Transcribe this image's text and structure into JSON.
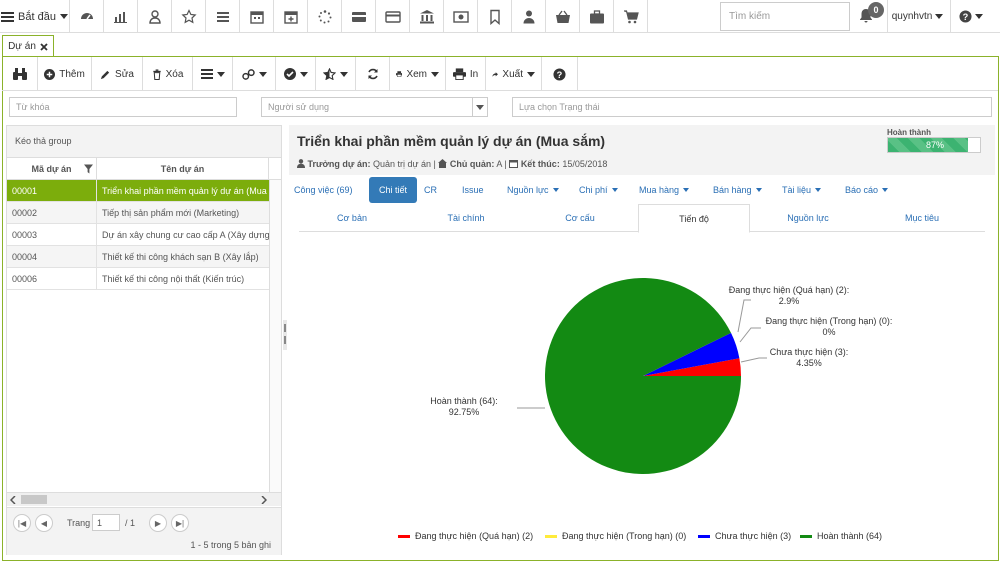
{
  "topbar": {
    "start_label": "Bắt đầu",
    "icons": [
      "dashboard-icon",
      "bar-chart-icon",
      "user-outline-icon",
      "star-icon",
      "list-icon",
      "calendar-icon",
      "calendar-plus-icon",
      "spinner-icon",
      "storage-icon",
      "credit-card-icon",
      "bank-icon",
      "money-icon",
      "bookmark-icon",
      "user-icon",
      "basket-icon",
      "briefcase-icon",
      "cart-icon"
    ],
    "search_placeholder": "Tìm kiếm",
    "notification_count": "0",
    "user_name": "quynhvtn"
  },
  "tab": {
    "label": "Dự án"
  },
  "toolbar": {
    "add_label": "Thêm",
    "edit_label": "Sửa",
    "delete_label": "Xóa",
    "view_label": "Xem",
    "print_label": "In",
    "export_label": "Xuất"
  },
  "filters": {
    "keyword_placeholder": "Từ khóa",
    "user_placeholder": "Người sử dụng",
    "status_placeholder": "Lựa chọn Trạng thái"
  },
  "grid": {
    "group_hint": "Kéo thả group",
    "col_code": "Mã dự án",
    "col_name": "Tên dự án",
    "rows": [
      {
        "code": "00001",
        "name": "Triển khai phần mềm quản lý dự án (Mua sắm)"
      },
      {
        "code": "00002",
        "name": "Tiếp thị sản phẩm mới (Marketing)"
      },
      {
        "code": "00003",
        "name": "Dự án xây chung cư cao cấp A (Xây dựng)"
      },
      {
        "code": "00004",
        "name": "Thiết kế thi công khách sạn B (Xây lắp)"
      },
      {
        "code": "00006",
        "name": "Thiết kế thi công nội thất (Kiến trúc)"
      }
    ],
    "pager_label": "Trang",
    "page": "1",
    "page_total": "/ 1",
    "summary": "1 - 5 trong 5 bản ghi"
  },
  "project": {
    "title": "Triển khai phần mềm quản lý dự án (Mua sắm)",
    "manager_label": "Trưởng dự án:",
    "manager": "Quản trị dự án |",
    "owner_label": "Chủ quản:",
    "owner": "A |",
    "end_label": "Kết thúc:",
    "end_date": "15/05/2018",
    "done_label": "Hoàn thành",
    "progress_text": "87%",
    "progress": 87
  },
  "tabs_primary": [
    "Công việc (69)",
    "Chi tiết",
    "CR",
    "Issue",
    "Nguồn lực",
    "Chi phí",
    "Mua hàng",
    "Bán hàng",
    "Tài liệu",
    "Báo cáo"
  ],
  "tabs_secondary": [
    "Cơ bản",
    "Tài chính",
    "Cơ cấu",
    "Tiến độ",
    "Nguồn lực",
    "Mục tiêu"
  ],
  "chart_data": {
    "type": "pie",
    "series": [
      {
        "name": "Đang thực hiện (Quá hạn)",
        "value": 2,
        "percent": "2.9%",
        "label": "Đang thực hiện (Quá hạn) (2):",
        "color": "#ff0000"
      },
      {
        "name": "Đang thực hiện (Trong hạn)",
        "value": 0,
        "percent": "0%",
        "label": "Đang thực hiện (Trong hạn) (0):",
        "color": "#ffeb3b"
      },
      {
        "name": "Chưa thực hiện",
        "value": 3,
        "percent": "4.35%",
        "label": "Chưa thực hiện (3):",
        "color": "#0000ff"
      },
      {
        "name": "Hoàn thành",
        "value": 64,
        "percent": "92.75%",
        "label": "Hoàn thành (64):",
        "color": "#138a13"
      }
    ],
    "legend": [
      "Đang thực hiện (Quá hạn) (2)",
      "Đang thực hiện (Trong hạn) (0)",
      "Chưa thực hiện (3)",
      "Hoàn thành (64)"
    ],
    "legend_position": "bottom"
  }
}
